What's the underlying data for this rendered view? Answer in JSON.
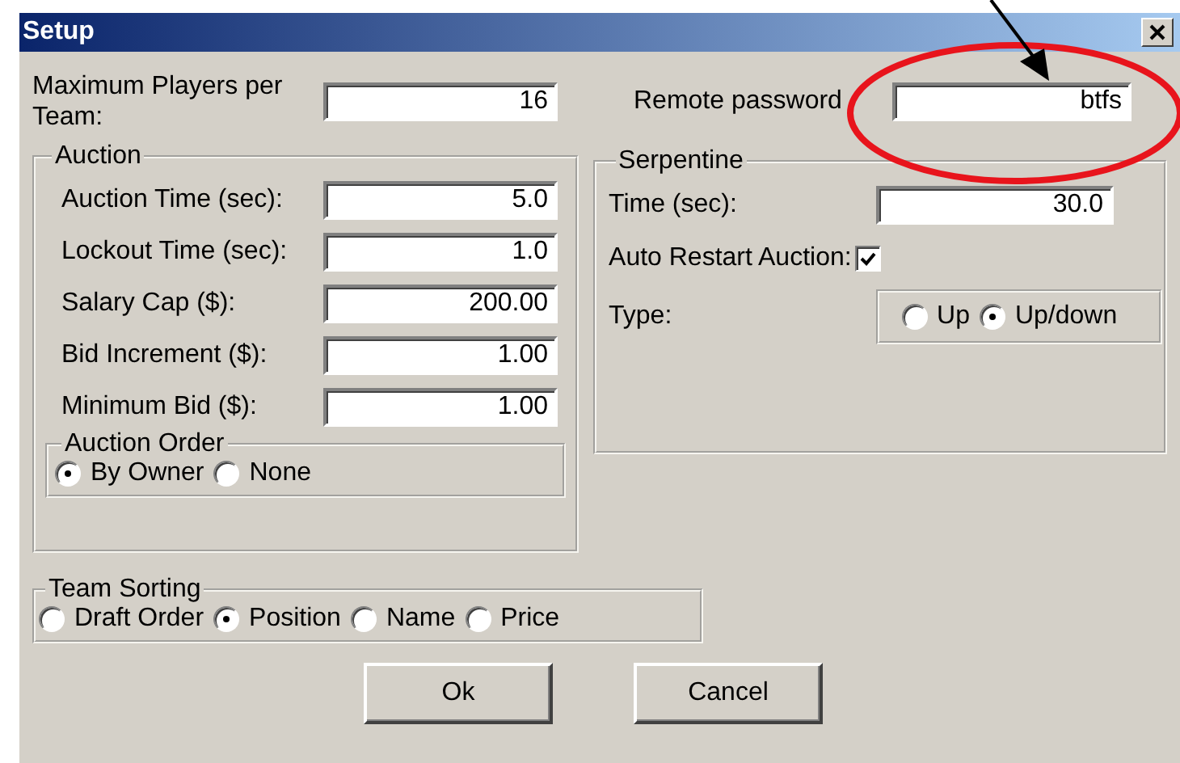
{
  "window": {
    "title": "Setup"
  },
  "max_players": {
    "label": "Maximum Players per Team:",
    "value": "16"
  },
  "remote_password": {
    "label": "Remote password",
    "value": "btfs"
  },
  "auction": {
    "title": "Auction",
    "fields": [
      {
        "label": "Auction Time (sec):",
        "value": "5.0"
      },
      {
        "label": "Lockout Time (sec):",
        "value": "1.0"
      },
      {
        "label": "Salary Cap ($):",
        "value": "200.00"
      },
      {
        "label": "Bid Increment ($):",
        "value": "1.00"
      },
      {
        "label": "Minimum Bid ($):",
        "value": "1.00"
      }
    ],
    "order": {
      "title": "Auction Order",
      "options": [
        {
          "label": "By Owner",
          "selected": true
        },
        {
          "label": "None",
          "selected": false
        }
      ]
    }
  },
  "serpentine": {
    "title": "Serpentine",
    "time": {
      "label": "Time (sec):",
      "value": "30.0"
    },
    "auto_restart": {
      "label": "Auto Restart Auction:",
      "checked": true
    },
    "type": {
      "label": "Type:",
      "options": [
        {
          "label": "Up",
          "selected": false
        },
        {
          "label": "Up/down",
          "selected": true
        }
      ]
    }
  },
  "team_sorting": {
    "title": "Team Sorting",
    "options": [
      {
        "label": "Draft Order",
        "selected": false
      },
      {
        "label": "Position",
        "selected": true
      },
      {
        "label": "Name",
        "selected": false
      },
      {
        "label": "Price",
        "selected": false
      }
    ]
  },
  "buttons": [
    "Ok",
    "Cancel"
  ]
}
